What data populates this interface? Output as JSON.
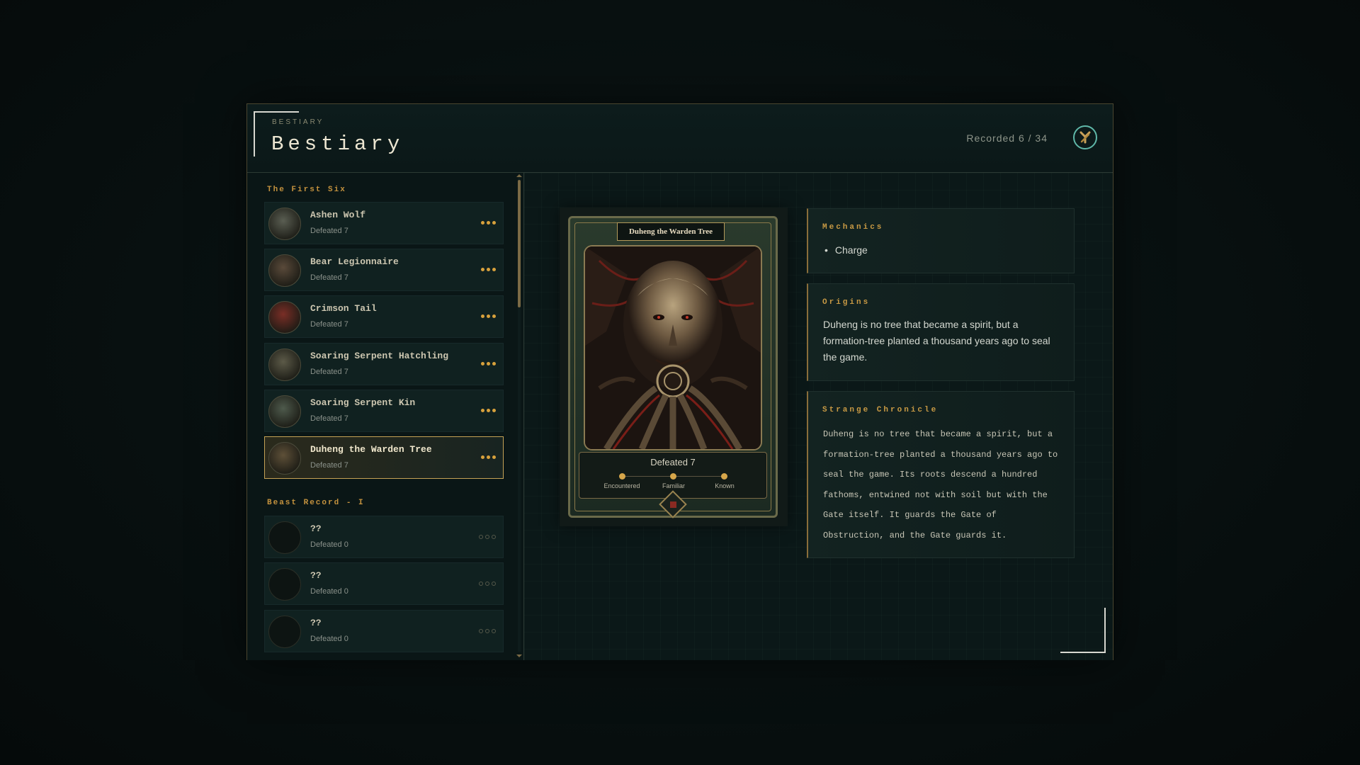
{
  "header": {
    "eyebrow": "BESTIARY",
    "title": "Bestiary",
    "recorded": "Recorded 6 / 34"
  },
  "sidebar": {
    "sections": [
      {
        "label": "The First Six"
      },
      {
        "label": "Beast Record - I"
      }
    ],
    "entries": [
      {
        "name": "Ashen Wolf",
        "status": "Defeated 7",
        "known": true,
        "active": false,
        "color": "#5a5e52"
      },
      {
        "name": "Bear Legionnaire",
        "status": "Defeated 7",
        "known": true,
        "active": false,
        "color": "#5a4a3a"
      },
      {
        "name": "Crimson Tail",
        "status": "Defeated 7",
        "known": true,
        "active": false,
        "color": "#7a2e26"
      },
      {
        "name": "Soaring Serpent Hatchling",
        "status": "Defeated 7",
        "known": true,
        "active": false,
        "color": "#5c5a48"
      },
      {
        "name": "Soaring Serpent Kin",
        "status": "Defeated 7",
        "known": true,
        "active": false,
        "color": "#4e5a4c"
      },
      {
        "name": "Duheng the Warden Tree",
        "status": "Defeated 7",
        "known": true,
        "active": true,
        "color": "#5e5038"
      },
      {
        "name": "??",
        "status": "Defeated 0",
        "known": false,
        "active": false,
        "color": "#0d1412"
      },
      {
        "name": "??",
        "status": "Defeated 0",
        "known": false,
        "active": false,
        "color": "#0d1412"
      },
      {
        "name": "??",
        "status": "Defeated 0",
        "known": false,
        "active": false,
        "color": "#0d1412"
      }
    ]
  },
  "card": {
    "name": "Duheng the Warden Tree",
    "defeated": "Defeated 7",
    "track": [
      {
        "label": "Encountered"
      },
      {
        "label": "Familiar"
      },
      {
        "label": "Known"
      }
    ]
  },
  "mechanics": {
    "title": "Mechanics",
    "items": [
      "Charge"
    ]
  },
  "origins": {
    "title": "Origins",
    "text": "Duheng is no tree that became a spirit, but a formation-tree planted a thousand years ago to seal the game."
  },
  "chronicle": {
    "title": "Strange Chronicle",
    "text": "Duheng is no tree that became a spirit, but a formation-tree planted a thousand years ago to seal the game. Its roots descend a hundred fathoms, entwined not with soil but with the Gate itself. It guards the Gate of Obstruction, and the Gate guards it."
  },
  "colors": {
    "accent": "#c99a44",
    "active_border": "#c5a255",
    "close_ring": "#5fb8a9"
  }
}
